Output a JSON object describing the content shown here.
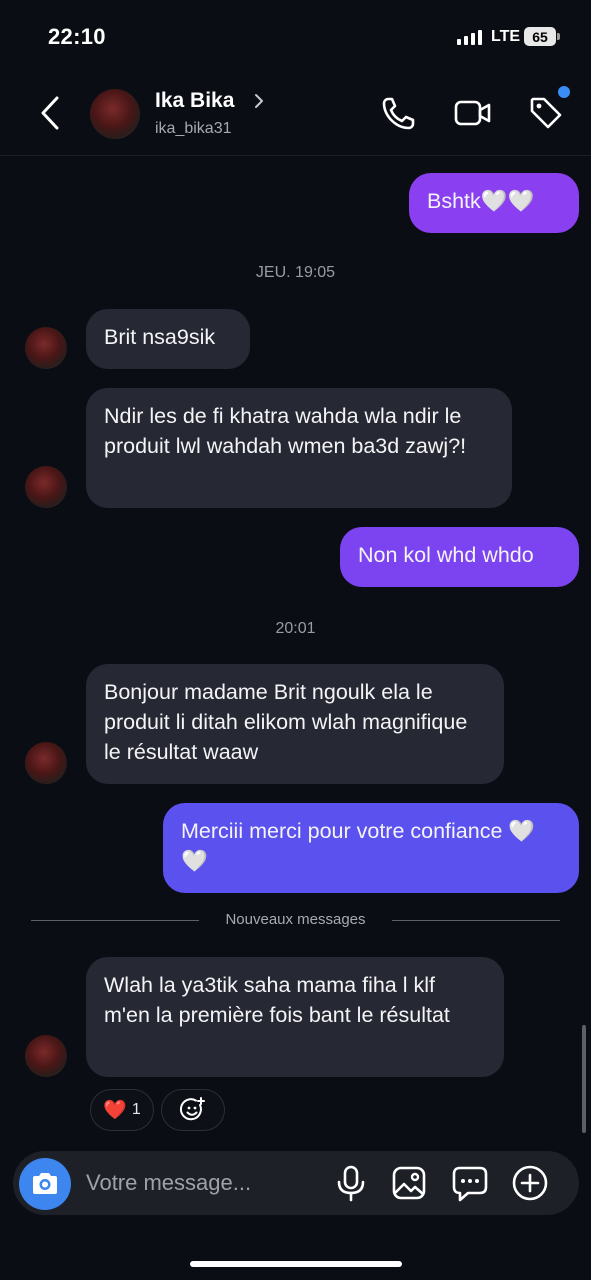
{
  "status_bar": {
    "time": "22:10",
    "network": "LTE",
    "battery": "65"
  },
  "header": {
    "contact_name": "Ika Bika",
    "username": "ika_bika31"
  },
  "messages": [
    {
      "from": "me",
      "text": "Bshtk🤍🤍"
    },
    {
      "type": "timestamp",
      "text": "JEU. 19:05"
    },
    {
      "from": "them",
      "text": "Brit nsa9sik"
    },
    {
      "from": "them",
      "text": "Ndir les de fi khatra wahda wla ndir le produit lwl wahdah wmen ba3d zawj?!"
    },
    {
      "from": "me",
      "text": "Non kol whd whdo"
    },
    {
      "type": "timestamp",
      "text": "20:01"
    },
    {
      "from": "them",
      "text": "Bonjour madame Brit ngoulk ela le produit li ditah elikom wlah magnifique le résultat waaw"
    },
    {
      "from": "me",
      "text": "Merciii merci pour votre confiance 🤍🤍"
    },
    {
      "type": "divider",
      "text": "Nouveaux messages"
    },
    {
      "from": "them",
      "text": "Wlah la ya3tik saha mama fiha l klf m'en la première fois bant le résultat"
    }
  ],
  "reaction": {
    "emoji": "❤️",
    "count": "1"
  },
  "composer": {
    "placeholder": "Votre message..."
  },
  "colors": {
    "background": "#0b0d14",
    "incoming_bubble": "#262933",
    "outgoing_purple": "#8a3ff0",
    "outgoing_blue": "#5a51ee",
    "accent_blue": "#3d86f0"
  },
  "icons": {
    "back": "chevron-left-icon",
    "call": "phone-icon",
    "video": "video-camera-icon",
    "tag": "tag-icon",
    "camera": "camera-icon",
    "mic": "microphone-icon",
    "gallery": "image-icon",
    "sticker": "chat-bubble-icon",
    "add": "plus-circle-icon",
    "add_reaction": "add-reaction-icon"
  }
}
